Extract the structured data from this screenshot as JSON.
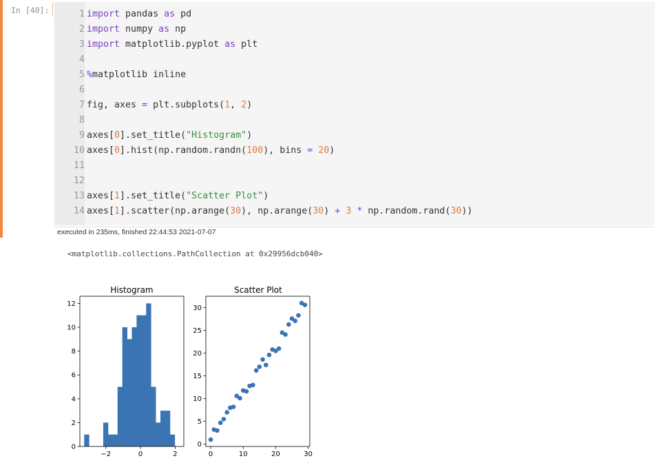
{
  "cell": {
    "prompt": "In [40]:",
    "lines": [
      {
        "n": "1",
        "parts": [
          [
            "kw",
            "import"
          ],
          [
            "t",
            " pandas "
          ],
          [
            "kw",
            "as"
          ],
          [
            "t",
            " pd"
          ]
        ]
      },
      {
        "n": "2",
        "parts": [
          [
            "kw",
            "import"
          ],
          [
            "t",
            " numpy "
          ],
          [
            "kw",
            "as"
          ],
          [
            "t",
            " np"
          ]
        ]
      },
      {
        "n": "3",
        "parts": [
          [
            "kw",
            "import"
          ],
          [
            "t",
            " matplotlib.pyplot "
          ],
          [
            "kw",
            "as"
          ],
          [
            "t",
            " plt"
          ]
        ]
      },
      {
        "n": "4",
        "parts": []
      },
      {
        "n": "5",
        "parts": [
          [
            "pct",
            "%"
          ],
          [
            "t",
            "matplotlib inline"
          ]
        ]
      },
      {
        "n": "6",
        "parts": []
      },
      {
        "n": "7",
        "parts": [
          [
            "t",
            "fig, axes "
          ],
          [
            "op",
            "="
          ],
          [
            "t",
            " plt.subplots("
          ],
          [
            "num",
            "1"
          ],
          [
            "t",
            ", "
          ],
          [
            "num",
            "2"
          ],
          [
            "t",
            ")"
          ]
        ]
      },
      {
        "n": "8",
        "parts": []
      },
      {
        "n": "9",
        "parts": [
          [
            "t",
            "axes["
          ],
          [
            "num",
            "0"
          ],
          [
            "t",
            "].set_title("
          ],
          [
            "str",
            "\"Histogram\""
          ],
          [
            "t",
            ")"
          ]
        ]
      },
      {
        "n": "10",
        "parts": [
          [
            "t",
            "axes["
          ],
          [
            "num",
            "0"
          ],
          [
            "t",
            "].hist(np.random.randn("
          ],
          [
            "num",
            "100"
          ],
          [
            "t",
            "), bins "
          ],
          [
            "op",
            "="
          ],
          [
            "t",
            " "
          ],
          [
            "num",
            "20"
          ],
          [
            "t",
            ")"
          ]
        ]
      },
      {
        "n": "11",
        "parts": []
      },
      {
        "n": "12",
        "parts": []
      },
      {
        "n": "13",
        "parts": [
          [
            "t",
            "axes["
          ],
          [
            "num",
            "1"
          ],
          [
            "t",
            "].set_title("
          ],
          [
            "str",
            "\"Scatter Plot\""
          ],
          [
            "t",
            ")"
          ]
        ]
      },
      {
        "n": "14",
        "parts": [
          [
            "t",
            "axes["
          ],
          [
            "num",
            "1"
          ],
          [
            "t",
            "].scatter(np.arange("
          ],
          [
            "num",
            "30"
          ],
          [
            "t",
            "), np.arange("
          ],
          [
            "num",
            "30"
          ],
          [
            "t",
            ") "
          ],
          [
            "op",
            "+"
          ],
          [
            "t",
            " "
          ],
          [
            "num",
            "3"
          ],
          [
            "t",
            " "
          ],
          [
            "op",
            "*"
          ],
          [
            "t",
            " np.random.rand("
          ],
          [
            "num",
            "30"
          ],
          [
            "t",
            "))"
          ]
        ]
      }
    ],
    "executed": "executed in 235ms, finished 22:44:53 2021-07-07"
  },
  "output": {
    "text": "<matplotlib.collections.PathCollection at 0x29956dcb040>"
  },
  "colors": {
    "bar": "#3a74b3",
    "marker": "#3a74b3",
    "accent": "#f0883e"
  },
  "chart_data": [
    {
      "type": "bar",
      "title": "Histogram",
      "bin_edges": [
        -3.25,
        -2.975,
        -2.7,
        -2.425,
        -2.15,
        -1.875,
        -1.6,
        -1.325,
        -1.05,
        -0.775,
        -0.5,
        -0.225,
        0.05,
        0.325,
        0.6,
        0.875,
        1.15,
        1.425,
        1.7,
        1.975,
        2.25
      ],
      "values": [
        1,
        0,
        0,
        0,
        2,
        1,
        1,
        5,
        10,
        9,
        10,
        11,
        11,
        12,
        5,
        2,
        3,
        3,
        1,
        0
      ],
      "xticks": [
        "−2",
        "0",
        "2"
      ],
      "xtick_values": [
        -2,
        0,
        2
      ],
      "yticks": [
        "0",
        "2",
        "4",
        "6",
        "8",
        "10",
        "12"
      ],
      "xlim": [
        -3.5,
        2.5
      ],
      "ylim": [
        0,
        12.6
      ]
    },
    {
      "type": "scatter",
      "title": "Scatter Plot",
      "x": [
        0,
        1,
        2,
        3,
        4,
        5,
        6,
        7,
        8,
        9,
        10,
        11,
        12,
        13,
        14,
        15,
        16,
        17,
        18,
        19,
        20,
        21,
        22,
        23,
        24,
        25,
        26,
        27,
        28,
        29
      ],
      "y": [
        1,
        3.2,
        3,
        4.7,
        5.5,
        7,
        8,
        8.2,
        10.6,
        10.1,
        11.8,
        11.6,
        12.8,
        13,
        16.2,
        17,
        18.6,
        17.4,
        19.6,
        20.8,
        20.5,
        21,
        24.5,
        24.1,
        26.3,
        27.6,
        27.1,
        28.3,
        31.0,
        30.6
      ],
      "xticks": [
        "0",
        "10",
        "20",
        "30"
      ],
      "xtick_values": [
        0,
        10,
        20,
        30
      ],
      "yticks": [
        "0",
        "5",
        "10",
        "15",
        "20",
        "25",
        "30"
      ],
      "ytick_values": [
        0,
        5,
        10,
        15,
        20,
        25,
        30
      ],
      "xlim": [
        -1.5,
        30.5
      ],
      "ylim": [
        -0.5,
        32.5
      ]
    }
  ]
}
